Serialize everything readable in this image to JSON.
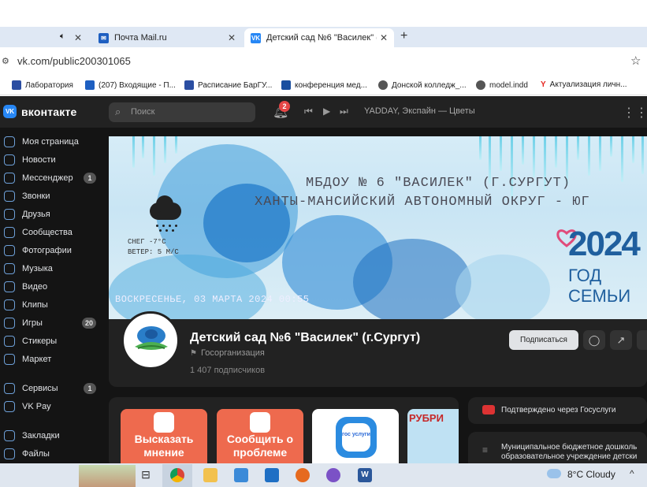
{
  "browser": {
    "tabs": [
      {
        "label": "",
        "icon": "speaker-icon"
      },
      {
        "label": "Почта Mail.ru",
        "icon": "mail-icon"
      },
      {
        "label": "Детский сад №6 \"Василек\" (г.С",
        "icon": "vk-icon"
      }
    ],
    "new_tab": "+",
    "close": "✕",
    "url": "vk.com/public200301065",
    "bookmarks": [
      {
        "label": "Лаборатория",
        "color": "#2b4ea2"
      },
      {
        "label": "(207) Входящие - П...",
        "color": "#1e5fc1"
      },
      {
        "label": "Расписание БарГУ...",
        "color": "#2b4ea2"
      },
      {
        "label": "конференция мед...",
        "color": "#1a4f9f"
      },
      {
        "label": "Донской колледж_...",
        "color": "#555555"
      },
      {
        "label": "model.indd",
        "color": "#555555"
      },
      {
        "label": "Актуализация личн...",
        "color": "#e52620"
      }
    ]
  },
  "vk": {
    "logo_text": "вконтакте",
    "logo_mark": "VK",
    "search_placeholder": "Поиск",
    "notif_count": "2",
    "now_playing": "YADDAY, Экспайн — Цветы",
    "sidebar": [
      {
        "label": "Моя страница",
        "badge": ""
      },
      {
        "label": "Новости",
        "badge": ""
      },
      {
        "label": "Мессенджер",
        "badge": "1"
      },
      {
        "label": "Звонки",
        "badge": ""
      },
      {
        "label": "Друзья",
        "badge": ""
      },
      {
        "label": "Сообщества",
        "badge": ""
      },
      {
        "label": "Фотографии",
        "badge": ""
      },
      {
        "label": "Музыка",
        "badge": ""
      },
      {
        "label": "Видео",
        "badge": ""
      },
      {
        "label": "Клипы",
        "badge": ""
      },
      {
        "label": "Игры",
        "badge": "20"
      },
      {
        "label": "Стикеры",
        "badge": ""
      },
      {
        "label": "Маркет",
        "badge": ""
      },
      {
        "label": "Сервисы",
        "badge": "1"
      },
      {
        "label": "VK Pay",
        "badge": ""
      },
      {
        "label": "Закладки",
        "badge": ""
      },
      {
        "label": "Файлы",
        "badge": ""
      }
    ],
    "cover": {
      "line1": "МБДОУ № 6 \"ВАСИЛЕК\" (Г.СУРГУТ)",
      "line2": "ХАНТЫ-МАНСИЙСКИЙ АВТОНОМНЫЙ ОКРУГ - ЮГ",
      "weather_line1": "СНЕГ -7°C",
      "weather_line2": "ВЕТЕР: 5 М/С",
      "datetime": "ВОСКРЕСЕНЬЕ, 03 МАРТА 2024 00:55",
      "year": "2024",
      "year_sub": "ГОД СЕМЬИ"
    },
    "group": {
      "name": "Детский сад №6 \"Василек\" (г.Сургут)",
      "type": "Госорганизация",
      "subscribers": "1 407 подписчиков",
      "subscribe_label": "Подписаться"
    },
    "cards": [
      {
        "label": "Высказать мнение",
        "color": "#ee6a4e"
      },
      {
        "label": "Сообщить о проблеме",
        "color": "#ee6a4e"
      },
      {
        "label": "",
        "color": "#ffffff"
      },
      {
        "label": "РУБРИ",
        "color": "#bfe1f3"
      }
    ],
    "card3_badge": "гос услуги",
    "verified": "Подтверждено через Госуслуги",
    "org_line1": "Муниципальное бюджетное дошколь",
    "org_line2": "образовательное учреждение детски"
  },
  "taskbar": {
    "temperature": "8°C",
    "condition": "Cloudy",
    "caret": "^"
  },
  "colors": {
    "vk_blue": "#2787f5",
    "vk_bg": "#141414",
    "vk_panel": "#222222",
    "accent_orange": "#ee6a4e"
  }
}
